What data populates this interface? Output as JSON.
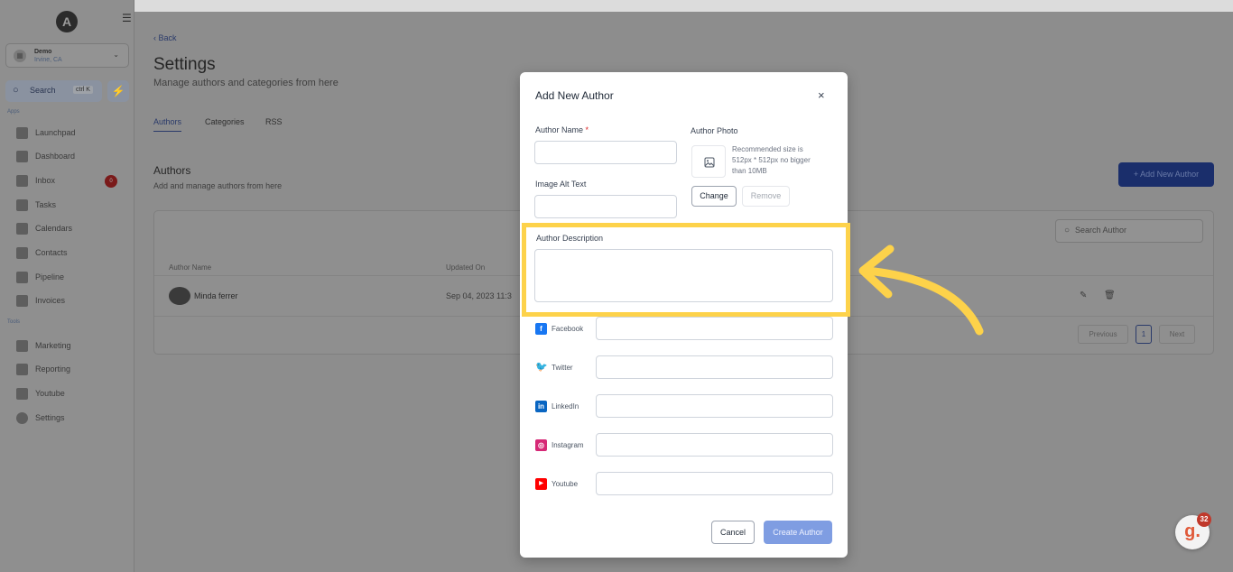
{
  "sidebar": {
    "logo": "A",
    "location": {
      "name": "Demo",
      "sub": "Irvine, CA"
    },
    "search": {
      "label": "Search",
      "shortcut": "ctrl K"
    },
    "sections": {
      "apps": "Apps",
      "tools": "Tools"
    },
    "apps": [
      {
        "label": "Launchpad",
        "icon": "rocket-icon"
      },
      {
        "label": "Dashboard",
        "icon": "grid-icon"
      },
      {
        "label": "Inbox",
        "icon": "inbox-icon",
        "badge": "0"
      },
      {
        "label": "Tasks",
        "icon": "clipboard-icon"
      },
      {
        "label": "Calendars",
        "icon": "calendar-icon"
      },
      {
        "label": "Contacts",
        "icon": "person-icon"
      },
      {
        "label": "Pipeline",
        "icon": "funnel-icon"
      },
      {
        "label": "Invoices",
        "icon": "invoice-icon"
      }
    ],
    "tools": [
      {
        "label": "Marketing",
        "icon": "megaphone-icon"
      },
      {
        "label": "Reporting",
        "icon": "pie-chart-icon"
      },
      {
        "label": "Youtube",
        "icon": "youtube-icon"
      },
      {
        "label": "Settings",
        "icon": "gear-icon"
      }
    ]
  },
  "page": {
    "back": "Back",
    "title": "Settings",
    "subtitle": "Manage authors and categories from here",
    "tabs": [
      "Authors",
      "Categories",
      "RSS"
    ],
    "section_title": "Authors",
    "section_subtitle": "Add and manage authors from here",
    "add_button": "+ Add New Author",
    "search_placeholder": "Search Author",
    "table": {
      "headers": [
        "Author Name",
        "Updated On"
      ],
      "rows": [
        {
          "name": "Minda ferrer",
          "updated": "Sep 04, 2023 11:3"
        }
      ]
    },
    "pagination": {
      "previous": "Previous",
      "current": "1",
      "next": "Next"
    }
  },
  "modal": {
    "title": "Add New Author",
    "close": "×",
    "author_name_label": "Author Name",
    "required_mark": "*",
    "author_photo_label": "Author Photo",
    "photo_hint": "Recommended size is 512px * 512px no bigger than 10MB",
    "change_button": "Change",
    "remove_button": "Remove",
    "alt_text_label": "Image Alt Text",
    "description_label": "Author Description",
    "socials": [
      {
        "label": "Facebook",
        "icon": "facebook-icon",
        "color": "#1877f2",
        "glyph": "f"
      },
      {
        "label": "Twitter",
        "icon": "twitter-icon",
        "color": "#1d9bf0",
        "glyph": "🐦"
      },
      {
        "label": "LinkedIn",
        "icon": "linkedin-icon",
        "color": "#0a66c2",
        "glyph": "in"
      },
      {
        "label": "Instagram",
        "icon": "instagram-icon",
        "color": "#d62976",
        "glyph": "◎"
      },
      {
        "label": "Youtube",
        "icon": "youtube-icon",
        "color": "#ff0000",
        "glyph": "▶"
      }
    ],
    "cancel_button": "Cancel",
    "create_button": "Create Author"
  },
  "help_badge": {
    "glyph": "g.",
    "count": "32"
  },
  "colors": {
    "highlight": "#fdd24a",
    "primary": "#1a3fbf",
    "overlay": "#8d8d8d"
  }
}
